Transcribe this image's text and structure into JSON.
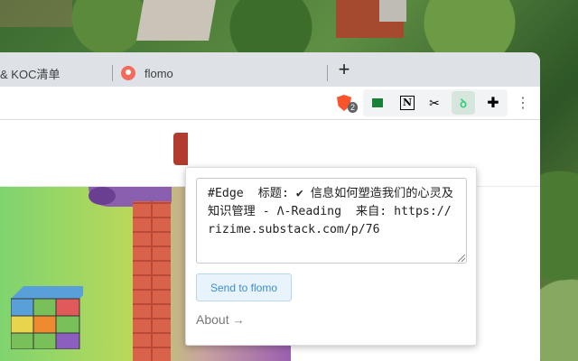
{
  "tabs": [
    {
      "label": "& KOC清单"
    },
    {
      "label": "flomo"
    }
  ],
  "newtab_glyph": "+",
  "toolbar": {
    "brave_badge": "2",
    "extensions": [
      "brave-shields-icon",
      "flag-icon",
      "notion-icon",
      "scissors-icon",
      "flomo-icon",
      "puzzle-icon",
      "menu-icon"
    ],
    "scissors_glyph": "✂",
    "flomo_glyph": "ꝺ",
    "puzzle_glyph": "✚",
    "menu_glyph": "⋮",
    "notion_glyph": "N"
  },
  "popup": {
    "memo_text": "#Edge  标题: ✔ 信息如何塑造我们的心灵及知识管理 - Λ-Reading  来自: https://rizime.substack.com/p/76",
    "send_label": "Send to flomo",
    "about_label": "About",
    "about_arrow": "→"
  },
  "colors": {
    "accent": "#3a8fd1",
    "flomo_green": "#30cf79"
  }
}
